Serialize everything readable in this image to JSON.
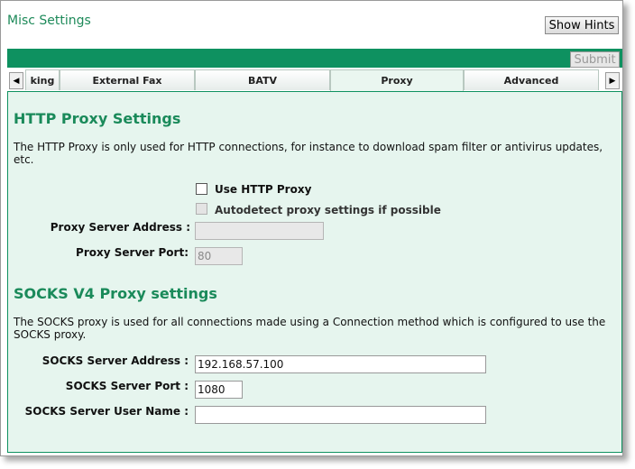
{
  "window": {
    "title": "Misc Settings"
  },
  "toolbar": {
    "show_hints_label": "Show Hints",
    "submit_label": "Submit"
  },
  "tabs": {
    "left_arrow": "◀",
    "right_arrow": "▶",
    "items": [
      {
        "label": "king"
      },
      {
        "label": "External Fax"
      },
      {
        "label": "BATV"
      },
      {
        "label": "Proxy",
        "active": true
      },
      {
        "label": "Advanced"
      }
    ]
  },
  "http_proxy": {
    "heading": "HTTP Proxy Settings",
    "description": "The HTTP Proxy is only used for HTTP connections, for instance to download spam filter or antivirus updates, etc.",
    "use_proxy": {
      "label": "Use HTTP Proxy",
      "checked": false
    },
    "autodetect": {
      "label": "Autodetect proxy settings if possible",
      "checked": false,
      "disabled": true
    },
    "server_address": {
      "label": "Proxy Server Address :",
      "value": ""
    },
    "server_port": {
      "label": "Proxy Server Port:",
      "value": "80"
    }
  },
  "socks_proxy": {
    "heading": "SOCKS V4 Proxy settings",
    "description": "The SOCKS proxy is used for all connections made using a Connection method which is configured to use the SOCKS proxy.",
    "server_address": {
      "label": "SOCKS Server Address :",
      "value": "192.168.57.100"
    },
    "server_port": {
      "label": "SOCKS Server Port :",
      "value": "1080"
    },
    "user_name": {
      "label": "SOCKS Server User Name :",
      "value": ""
    }
  },
  "colors": {
    "accent": "#0e9160",
    "heading": "#1a8a5a",
    "panel": "#e6f5ee"
  }
}
